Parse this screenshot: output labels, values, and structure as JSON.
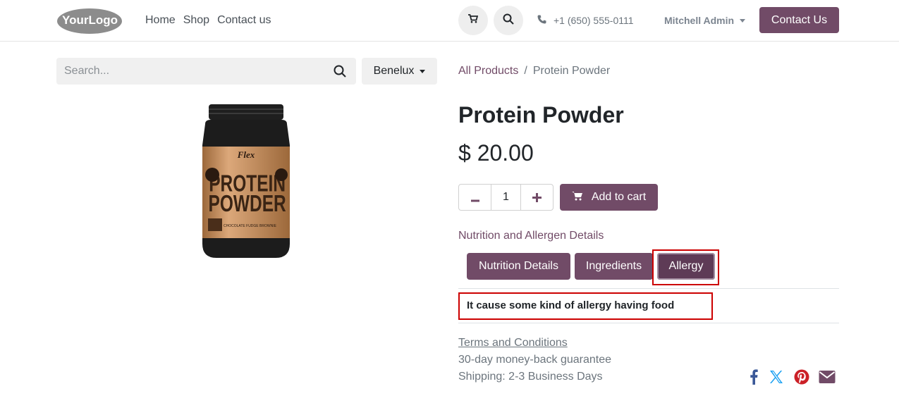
{
  "header": {
    "logo_text": "YourLogo",
    "nav": [
      "Home",
      "Shop",
      "Contact us"
    ],
    "phone": "+1 (650) 555-0111",
    "user_name": "Mitchell Admin",
    "contact_button": "Contact Us",
    "icons": {
      "cart": "cart-icon",
      "search": "search-icon",
      "phone": "phone-icon"
    }
  },
  "search": {
    "placeholder": "Search...",
    "value": ""
  },
  "pricelist": "Benelux",
  "breadcrumb": {
    "link": "All Products",
    "separator": "/",
    "current": "Protein Powder"
  },
  "product": {
    "name": "Protein Powder",
    "price": "$ 20.00",
    "quantity": "1",
    "add_to_cart": "Add to cart",
    "image_label": {
      "brand": "Flex",
      "line1": "PROTEIN",
      "line2": "POWDER",
      "flavor": "CHOCOLATE FUDGE BROWNIE"
    }
  },
  "details": {
    "section_label": "Nutrition and Allergen Details",
    "tabs": [
      "Nutrition Details",
      "Ingredients",
      "Allergy"
    ],
    "active_tab": "Allergy",
    "active_content": "It cause some kind of allergy having food"
  },
  "info": {
    "terms": "Terms and Conditions",
    "guarantee": "30-day money-back guarantee",
    "shipping": "Shipping: 2-3 Business Days"
  },
  "share_icons": [
    "facebook-icon",
    "x-twitter-icon",
    "pinterest-icon",
    "email-icon"
  ],
  "colors": {
    "brand": "#714b67",
    "highlight": "#cc0000",
    "facebook": "#3b5998",
    "x": "#1da1f2",
    "pinterest": "#cb2027",
    "email": "#714b67"
  }
}
